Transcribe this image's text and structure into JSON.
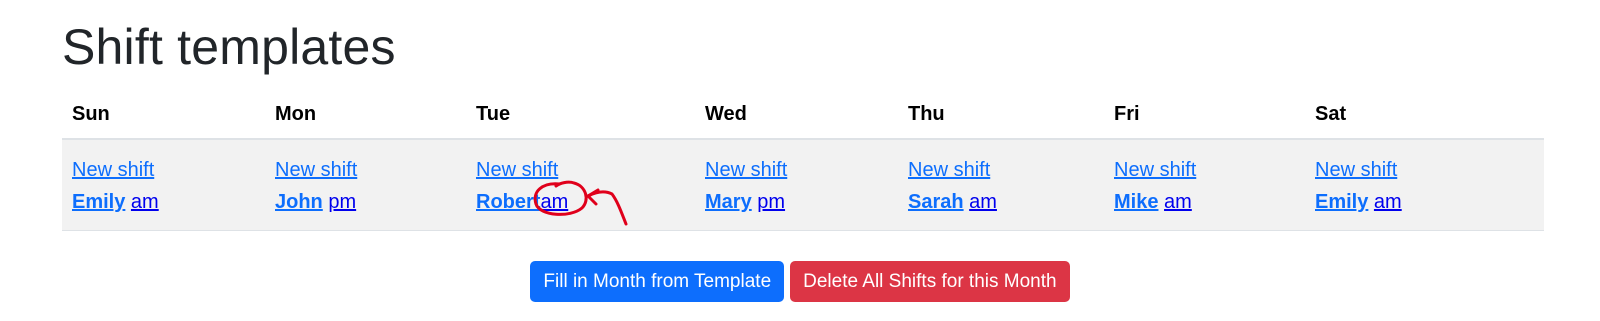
{
  "page": {
    "title": "Shift templates"
  },
  "days": [
    "Sun",
    "Mon",
    "Tue",
    "Wed",
    "Thu",
    "Fri",
    "Sat"
  ],
  "cells": [
    {
      "new_shift": "New shift",
      "person": "Emily",
      "period": "am"
    },
    {
      "new_shift": "New shift",
      "person": "John",
      "period": "pm"
    },
    {
      "new_shift": "New shift",
      "person": "Robert",
      "period": "am"
    },
    {
      "new_shift": "New shift",
      "person": "Mary",
      "period": "pm"
    },
    {
      "new_shift": "New shift",
      "person": "Sarah",
      "period": "am"
    },
    {
      "new_shift": "New shift",
      "person": "Mike",
      "period": "am"
    },
    {
      "new_shift": "New shift",
      "person": "Emily",
      "period": "am"
    }
  ],
  "buttons": {
    "fill_label": "Fill in Month from Template",
    "delete_label": "Delete All Shifts for this Month"
  },
  "colors": {
    "primary": "#0d6efd",
    "danger": "#dc3545",
    "row_background": "#f2f2f2",
    "annotation": "#e0001b"
  },
  "annotation": {
    "type": "hand-drawn circle and arrow",
    "target": "Tue am"
  }
}
